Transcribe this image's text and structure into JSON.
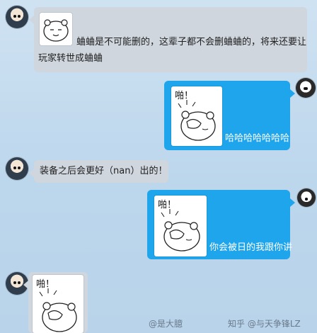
{
  "messages": [
    {
      "side": "left",
      "style": "grey",
      "text_line1": "蛐蛐是不可能删的，这辈子都不会删蛐蛐的，将来还要让",
      "text_line2": "玩家转世成蛐蛐"
    },
    {
      "side": "right",
      "style": "blue",
      "sticker_caption": "啪！",
      "text": "哈哈哈哈哈哈哈"
    },
    {
      "side": "left",
      "style": "grey",
      "text": "装备之后会更好（nan）出的！"
    },
    {
      "side": "right",
      "style": "blue",
      "sticker_caption": "啪！",
      "text": "你会被日的我跟你讲"
    },
    {
      "side": "left",
      "style": "grey",
      "sticker_caption": "啪！"
    }
  ],
  "watermarks": {
    "weibo": "@是大臆",
    "zhihu": "知乎 @与天争锋LZ"
  },
  "icons": [
    "user-avatar-icon",
    "girl-avatar-icon",
    "cartoon-bear-sticker",
    "slap-bear-sticker"
  ],
  "colors": {
    "blue_bubble": "#1ea5ec",
    "grey_bubble": "#cfd6de",
    "background": "#c4dbef"
  }
}
